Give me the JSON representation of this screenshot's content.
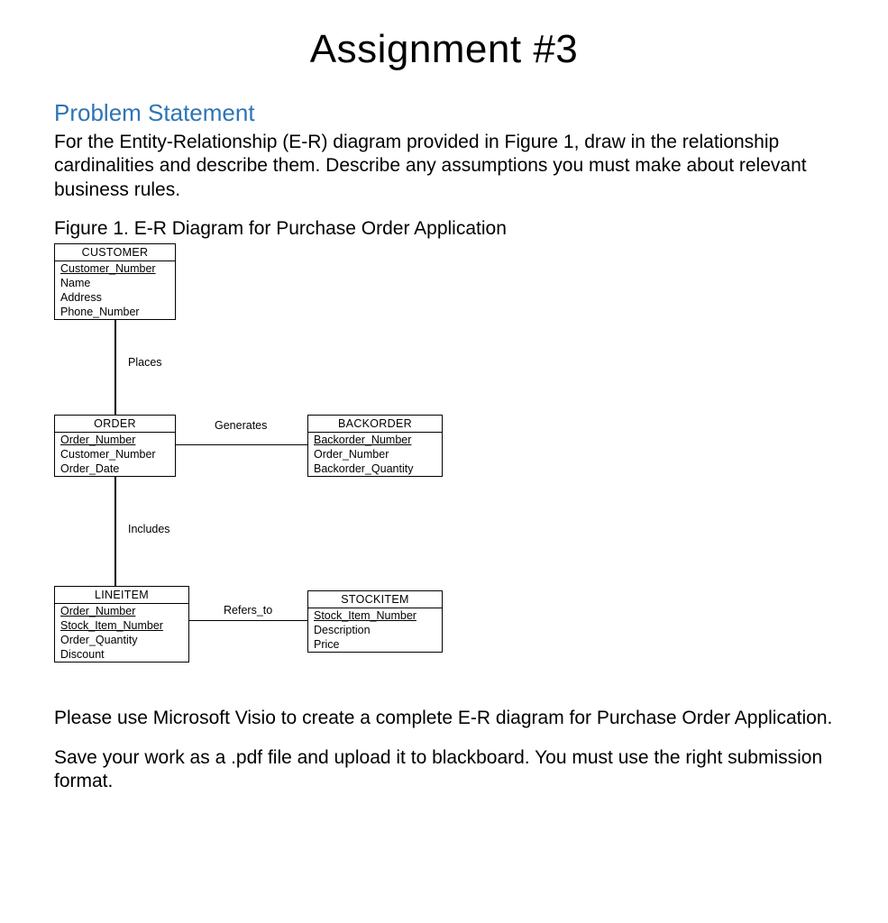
{
  "title": "Assignment #3",
  "section_heading": "Problem Statement",
  "intro": "For the Entity-Relationship (E-R) diagram provided in Figure 1, draw in the relationship cardinalities and describe them. Describe any assumptions you must make about relevant business rules.",
  "figure_caption": "Figure 1. E-R Diagram for Purchase Order Application",
  "outro1": "Please use Microsoft Visio to create a complete E-R diagram for Purchase Order Application.",
  "outro2": "Save your work as a .pdf file and upload it to blackboard. You must use the right submission format.",
  "er": {
    "entities": {
      "customer": {
        "name": "CUSTOMER",
        "pk": "Customer_Number",
        "attrs": [
          "Name",
          "Address",
          "Phone_Number"
        ]
      },
      "order": {
        "name": "ORDER",
        "pk": "Order_Number",
        "attrs": [
          "Customer_Number",
          "Order_Date"
        ]
      },
      "backorder": {
        "name": "BACKORDER",
        "pk": "Backorder_Number",
        "attrs": [
          "Order_Number",
          "Backorder_Quantity"
        ]
      },
      "lineitem": {
        "name": "LINEITEM",
        "pk1": "Order_Number",
        "pk2": "Stock_Item_Number",
        "attrs": [
          "Order_Quantity",
          "Discount"
        ]
      },
      "stockitem": {
        "name": "STOCKITEM",
        "pk": "Stock_Item_Number",
        "attrs": [
          "Description",
          "Price"
        ]
      }
    },
    "relationships": {
      "places": "Places",
      "generates": "Generates",
      "includes": "Includes",
      "refers_to": "Refers_to"
    }
  }
}
